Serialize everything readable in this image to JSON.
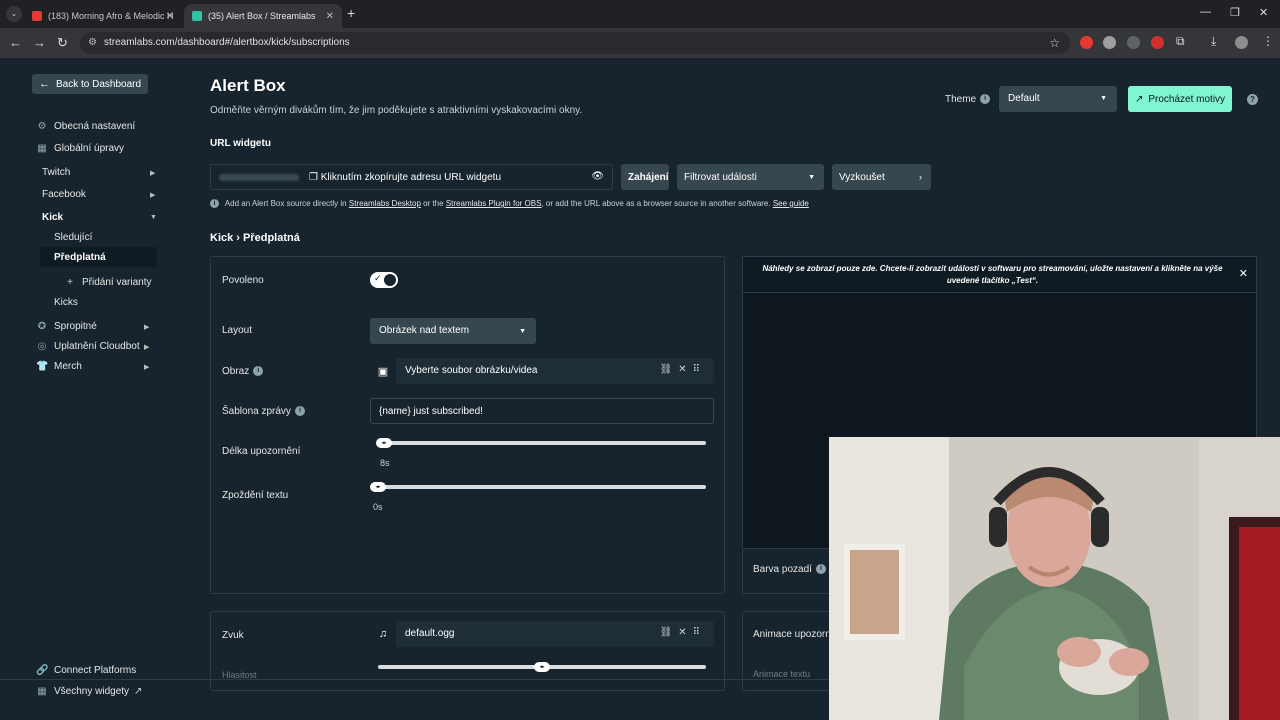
{
  "browser": {
    "tabs": [
      {
        "title": "(183) Morning Afro & Melodic H",
        "active": false,
        "color": "#e53935"
      },
      {
        "title": "(35) Alert Box / Streamlabs",
        "active": true,
        "color": "#31c3a2"
      }
    ],
    "url": "streamlabs.com/dashboard#/alertbox/kick/subscriptions"
  },
  "sidebar": {
    "back_label": "Back to Dashboard",
    "items": [
      {
        "label": "Obecná nastavení",
        "icon": "gear-icon"
      },
      {
        "label": "Globální úpravy",
        "icon": "grid-icon"
      },
      {
        "label": "Twitch"
      },
      {
        "label": "Facebook"
      },
      {
        "label": "Kick"
      },
      {
        "label": "Sledující"
      },
      {
        "label": "Předplatná"
      },
      {
        "label": "Přidání varianty"
      },
      {
        "label": "Kicks"
      },
      {
        "label": "Spropitné",
        "icon": "tip-icon"
      },
      {
        "label": "Uplatnění Cloudbot",
        "icon": "cloudbot-icon"
      },
      {
        "label": "Merch",
        "icon": "shirt-icon"
      }
    ],
    "connect_label": "Connect Platforms",
    "all_widgets_label": "Všechny widgety"
  },
  "header": {
    "title": "Alert Box",
    "subtitle": "Odměňte věrným divákům tím, že jim poděkujete s atraktivními vyskakovacími okny.",
    "theme_label": "Theme",
    "theme_value": "Default",
    "browse_label": "Procházet motivy"
  },
  "widget_url": {
    "label": "URL widgetu",
    "copy_text": "Kliknutím zkopírujte adresu URL widgetu",
    "launch_label": "Zahájení",
    "filter_label": "Filtrovat události",
    "test_label": "Vyzkoušet",
    "hint_prefix": "Add an Alert Box source directly in",
    "hint_link1": "Streamlabs Desktop",
    "hint_mid": "or the",
    "hint_link2": "Streamlabs Plugin for OBS",
    "hint_suffix": ", or add the URL above as a browser source in another software.",
    "hint_link3": "See guide"
  },
  "breadcrumb": "Kick › Předplatná",
  "settings": {
    "enabled_label": "Povoleno",
    "layout_label": "Layout",
    "layout_value": "Obrázek nad textem",
    "image_label": "Obraz",
    "image_value": "Vyberte soubor obrázku/videa",
    "template_label": "Šablona zprávy",
    "template_value": "{name} just subscribed!",
    "duration_label": "Délka upozornění",
    "duration_value": "8s",
    "text_delay_label": "Zpoždění textu",
    "text_delay_value": "0s",
    "sound_label": "Zvuk",
    "sound_value": "default.ogg",
    "volume_label": "Hlasitost"
  },
  "preview": {
    "note": "Náhledy se zobrazí pouze zde. Chcete-li zobrazit události v softwaru pro streamování, uložte nastavení a klikněte na výše uvedené tlačítko „Test“.",
    "bg_label": "Barva pozadí",
    "anim_label": "Animace upozornění",
    "anim_text_label": "Animace textu"
  }
}
